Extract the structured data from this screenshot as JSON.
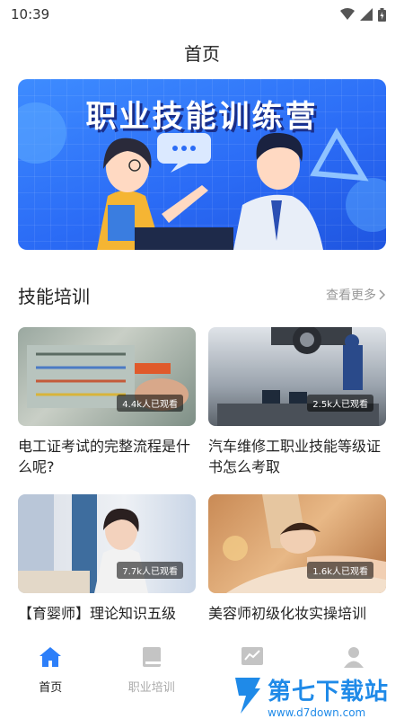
{
  "status_bar": {
    "time": "10:39"
  },
  "header": {
    "title": "首页"
  },
  "banner": {
    "title": "职业技能训练营",
    "accent_color": "#2b6cf6"
  },
  "section": {
    "title": "技能培训",
    "more_label": "查看更多"
  },
  "cards": [
    {
      "title": "电工证考试的完整流程是什么呢?",
      "views": "4.4k人已观看"
    },
    {
      "title": "汽车维修工职业技能等级证书怎么考取",
      "views": "2.5k人已观看"
    },
    {
      "title": "【育婴师】理论知识五级",
      "views": "7.7k人已观看"
    },
    {
      "title": "美容师初级化妆实操培训",
      "views": "1.6k人已观看"
    }
  ],
  "tabs": [
    {
      "label": "首页",
      "icon": "home-icon",
      "active": true
    },
    {
      "label": "职业培训",
      "icon": "book-icon",
      "active": false
    },
    {
      "label": "",
      "icon": "chart-icon",
      "active": false
    },
    {
      "label": "",
      "icon": "user-icon",
      "active": false
    }
  ],
  "watermark": {
    "brand": "第七下载站",
    "url": "www.d7down.com"
  },
  "colors": {
    "active_tab": "#2d7ff9",
    "inactive_tab": "#c4c4c4"
  }
}
